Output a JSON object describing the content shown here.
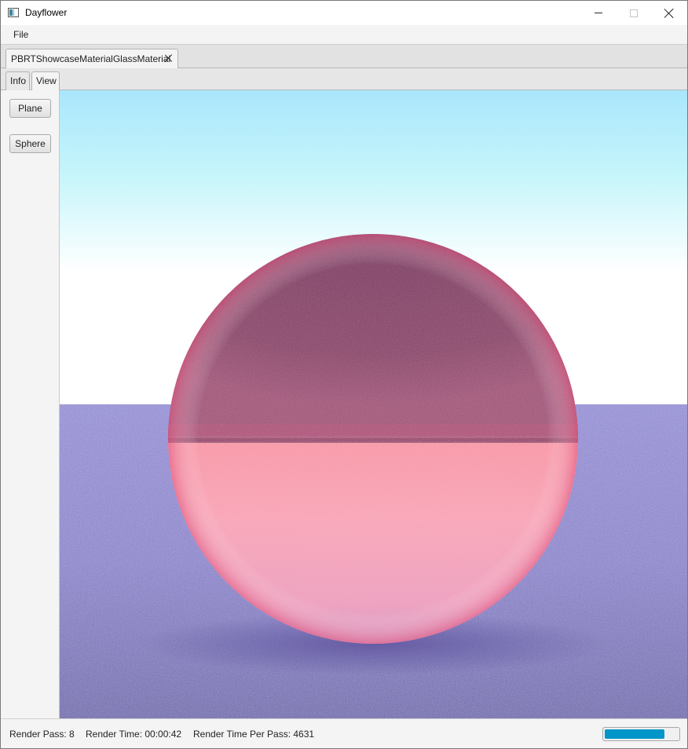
{
  "window": {
    "title": "Dayflower"
  },
  "menu": {
    "items": [
      "File"
    ]
  },
  "document_tab": {
    "label": "PBRTShowcaseMaterialGlassMaterial"
  },
  "inner_tabs": [
    "Info",
    "View"
  ],
  "toolbar": {
    "plane_label": "Plane",
    "sphere_label": "Sphere"
  },
  "status": {
    "render_pass": "Render Pass: 8",
    "render_time": "Render Time: 00:00:42",
    "render_time_per_pass": "Render Time Per Pass: 4631",
    "progress_fraction": 0.82
  },
  "colors": {
    "progress_fill": "#0096c9",
    "sky_top": "#a9e6fb",
    "sky_bottom": "#ffffff",
    "floor": "#8b83d6",
    "sphere_upper": "#8a3e63",
    "sphere_lower": "#ff9bb0"
  }
}
